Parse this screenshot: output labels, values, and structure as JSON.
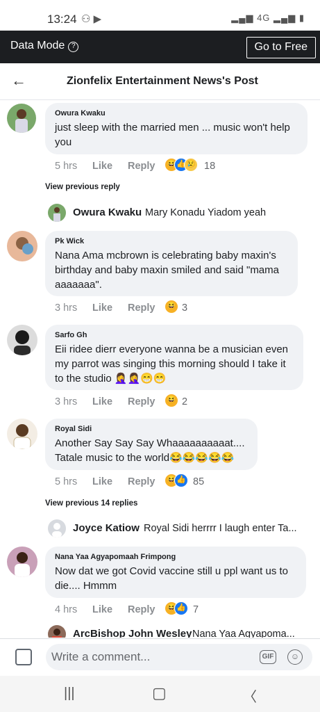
{
  "status_bar": {
    "time": "13:24",
    "left_icons": "⚇ ▶",
    "right_icons": "▂▄▆ 4G ▂▄▆ ▮"
  },
  "data_bar": {
    "label": "Data Mode",
    "info_icon": "?",
    "button": "Go to Free"
  },
  "header": {
    "back_icon": "←",
    "title": "Zionfelix Entertainment News's Post"
  },
  "comments": [
    {
      "name": "Owura Kwaku",
      "text": "just sleep with the married men ... music won't help you",
      "time": "5 hrs",
      "like": "Like",
      "reply": "Reply",
      "reactions": [
        "haha",
        "like",
        "sad"
      ],
      "count": "18"
    },
    {
      "name": "Pk Wick",
      "text": "Nana Ama mcbrown is celebrating baby maxin's birthday  and baby maxin smiled and said \"mama aaaaaaa\".",
      "time": "3 hrs",
      "like": "Like",
      "reply": "Reply",
      "reactions": [
        "haha"
      ],
      "count": "3"
    },
    {
      "name": "Sarfo Gh",
      "text": "Eii ridee dierr everyone wanna be a musician even my parrot was singing this morning should I take it to the studio 🤦‍♀️🤦‍♀️😁😁",
      "time": "3 hrs",
      "like": "Like",
      "reply": "Reply",
      "reactions": [
        "haha"
      ],
      "count": "2"
    },
    {
      "name": "Royal Sidi",
      "text": "Another Say Say Say Whaaaaaaaaaat.... Tatale music to the world😂😂😂😂😂",
      "time": "5 hrs",
      "like": "Like",
      "reply": "Reply",
      "reactions": [
        "haha",
        "like"
      ],
      "count": "85"
    },
    {
      "name": "Nana Yaa Agyapomaah Frimpong",
      "text": "Now dat we got Covid vaccine still u ppl want us to die.... Hmmm",
      "time": "4 hrs",
      "like": "Like",
      "reply": "Reply",
      "reactions": [
        "haha",
        "like"
      ],
      "count": "7"
    }
  ],
  "view_previous": [
    "View previous reply",
    "View previous 14 replies"
  ],
  "replies": [
    {
      "name": "Owura Kwaku",
      "text": "Mary Konadu Yiadom yeah"
    },
    {
      "name": "Joyce Katiow",
      "text": "Royal Sidi herrrr I laugh enter Ta..."
    },
    {
      "name": "ArcBishop John Wesley",
      "text": "Nana Yaa Agyapoma..."
    }
  ],
  "composer": {
    "placeholder": "Write a comment...",
    "gif": "GIF",
    "smile": "☺"
  },
  "nav": {
    "recents": "|||",
    "home": "▢",
    "back": "〈"
  },
  "colors": {
    "bubble": "#f0f2f5",
    "dark_bar": "#1c1e21",
    "like_blue": "#1877f2",
    "haha_yellow": "#f7b125"
  },
  "icons": [
    "person-icon",
    "play-icon",
    "signal-icon",
    "battery-icon",
    "info-icon",
    "back-arrow-icon",
    "photo-icon",
    "gif-icon",
    "emoji-icon",
    "haha-reaction-icon",
    "like-reaction-icon",
    "sad-reaction-icon"
  ]
}
